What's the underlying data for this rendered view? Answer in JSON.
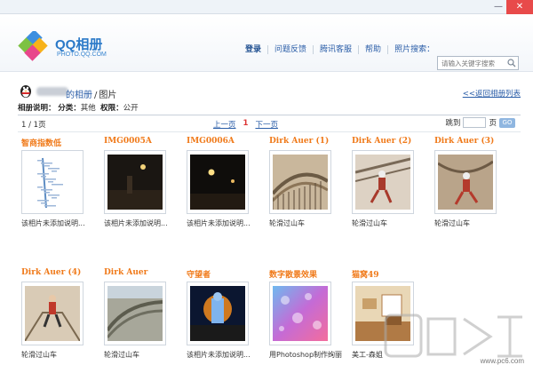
{
  "window": {
    "minimize": "—",
    "close": "✕"
  },
  "header": {
    "logo_title": "QQ相册",
    "logo_url": "PHOTO.QQ.COM",
    "nav": [
      "登录",
      "问题反馈",
      "腾讯客服",
      "帮助"
    ],
    "search_label": "照片搜索：",
    "search_placeholder": "请输入关键字搜索"
  },
  "breadcrumb": {
    "album": "的相册",
    "separator": "/",
    "current": "图片",
    "back_link": "<<返回相册列表"
  },
  "album_info": {
    "label": "相册说明：",
    "category_label": "分类：",
    "category": "其他",
    "permission_label": "权限：",
    "permission": "公开"
  },
  "pager": {
    "count": "1 / 1页",
    "prev": "上一页",
    "current": "1",
    "next": "下一页",
    "jump_label": "跳到",
    "page_label": "页",
    "go": "GO"
  },
  "photos": [
    {
      "title": "智商指数低",
      "desc": "该相片未添加说明...",
      "thumb": "chart"
    },
    {
      "title": "IMG0005A",
      "desc": "该相片未添加说明...",
      "thumb": "night1"
    },
    {
      "title": "IMG0006A",
      "desc": "该相片未添加说明...",
      "thumb": "night2"
    },
    {
      "title": "Dirk Auer (1)",
      "desc": "轮滑过山车",
      "thumb": "coaster1"
    },
    {
      "title": "Dirk Auer (2)",
      "desc": "轮滑过山车",
      "thumb": "skater1"
    },
    {
      "title": "Dirk Auer (3)",
      "desc": "轮滑过山车",
      "thumb": "skater2"
    },
    {
      "title": "Dirk Auer (4)",
      "desc": "轮滑过山车",
      "thumb": "skater3"
    },
    {
      "title": "Dirk Auer",
      "desc": "轮滑过山车",
      "thumb": "coaster2"
    },
    {
      "title": "守望者",
      "desc": "该相片未添加说明...",
      "thumb": "watchman"
    },
    {
      "title": "数字散景效果",
      "desc": "用Photoshop制作绚丽",
      "thumb": "bokeh"
    },
    {
      "title": "猫窝49",
      "desc": "美工-森姐",
      "thumb": "room"
    }
  ],
  "watermark": {
    "url": "www.pc6.com"
  },
  "colors": {
    "title_orange": "#f07a1a",
    "link_blue": "#2b5ea8",
    "logo_blue": "#2a79c8"
  }
}
